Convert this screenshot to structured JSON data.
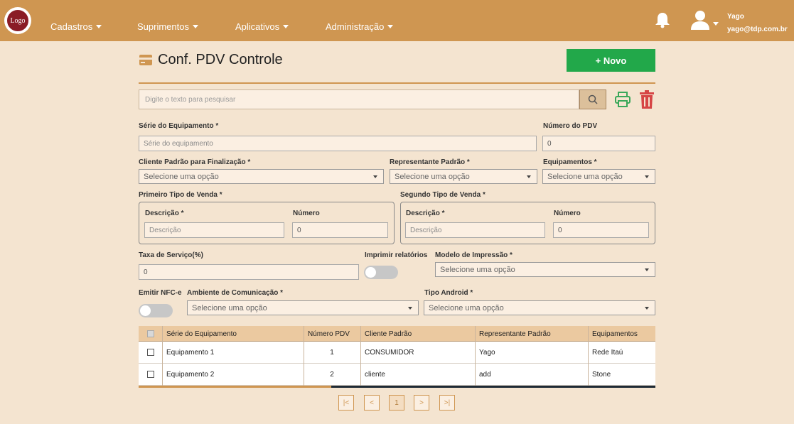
{
  "header": {
    "logo_text": "Logo",
    "nav": [
      "Cadastros",
      "Suprimentos",
      "Aplicativos",
      "Administração"
    ],
    "user": {
      "name": "Yago",
      "email": "yago@tdp.com.br"
    }
  },
  "page": {
    "title": "Conf. PDV Controle",
    "new_button": "+ Novo",
    "search_placeholder": "Digite o texto para pesquisar"
  },
  "form": {
    "serie": {
      "label": "Série do Equipamento *",
      "placeholder": "Série do equipamento"
    },
    "numero_pdv": {
      "label": "Número do PDV",
      "value": "0"
    },
    "cliente": {
      "label": "Cliente Padrão para Finalização *",
      "value": "Selecione uma opção"
    },
    "representante": {
      "label": "Representante Padrão *",
      "value": "Selecione uma opção"
    },
    "equipamentos": {
      "label": "Equipamentos *",
      "value": "Selecione uma opção"
    },
    "primeiro_tipo": {
      "legend": "Primeiro Tipo de Venda *",
      "descricao_label": "Descrição *",
      "descricao_placeholder": "Descrição",
      "numero_label": "Número",
      "numero_value": "0"
    },
    "segundo_tipo": {
      "legend": "Segundo Tipo de Venda *",
      "descricao_label": "Descrição *",
      "descricao_placeholder": "Descrição",
      "numero_label": "Número",
      "numero_value": "0"
    },
    "taxa": {
      "label": "Taxa de Serviço(%)",
      "value": "0"
    },
    "imprimir": {
      "label": "Imprimir relatórios",
      "on": false
    },
    "modelo": {
      "label": "Modelo de Impressão *",
      "value": "Selecione uma opção"
    },
    "nfce": {
      "label": "Emitir NFC-e",
      "on": false
    },
    "ambiente": {
      "label": "Ambiente de Comunicação *",
      "value": "Selecione uma opção"
    },
    "tipo_android": {
      "label": "Tipo Android *",
      "value": "Selecione uma opção"
    }
  },
  "table": {
    "columns": [
      "Série do Equipamento",
      "Número PDV",
      "Cliente Padrão",
      "Representante Padrão",
      "Equipamentos"
    ],
    "rows": [
      {
        "serie": "Equipamento 1",
        "numero": "1",
        "cliente": "CONSUMIDOR",
        "representante": "Yago",
        "equipamentos": "Rede Itaú"
      },
      {
        "serie": "Equipamento 2",
        "numero": "2",
        "cliente": "cliente",
        "representante": "add",
        "equipamentos": "Stone"
      }
    ]
  },
  "pagination": {
    "first": "|<",
    "prev": "<",
    "current": "1",
    "next": ">",
    "last": ">|"
  },
  "colors": {
    "brand": "#cf9651",
    "background": "#f4e4d0",
    "primary_button": "#22a84a",
    "print": "#3aa85a",
    "delete": "#d64545"
  }
}
